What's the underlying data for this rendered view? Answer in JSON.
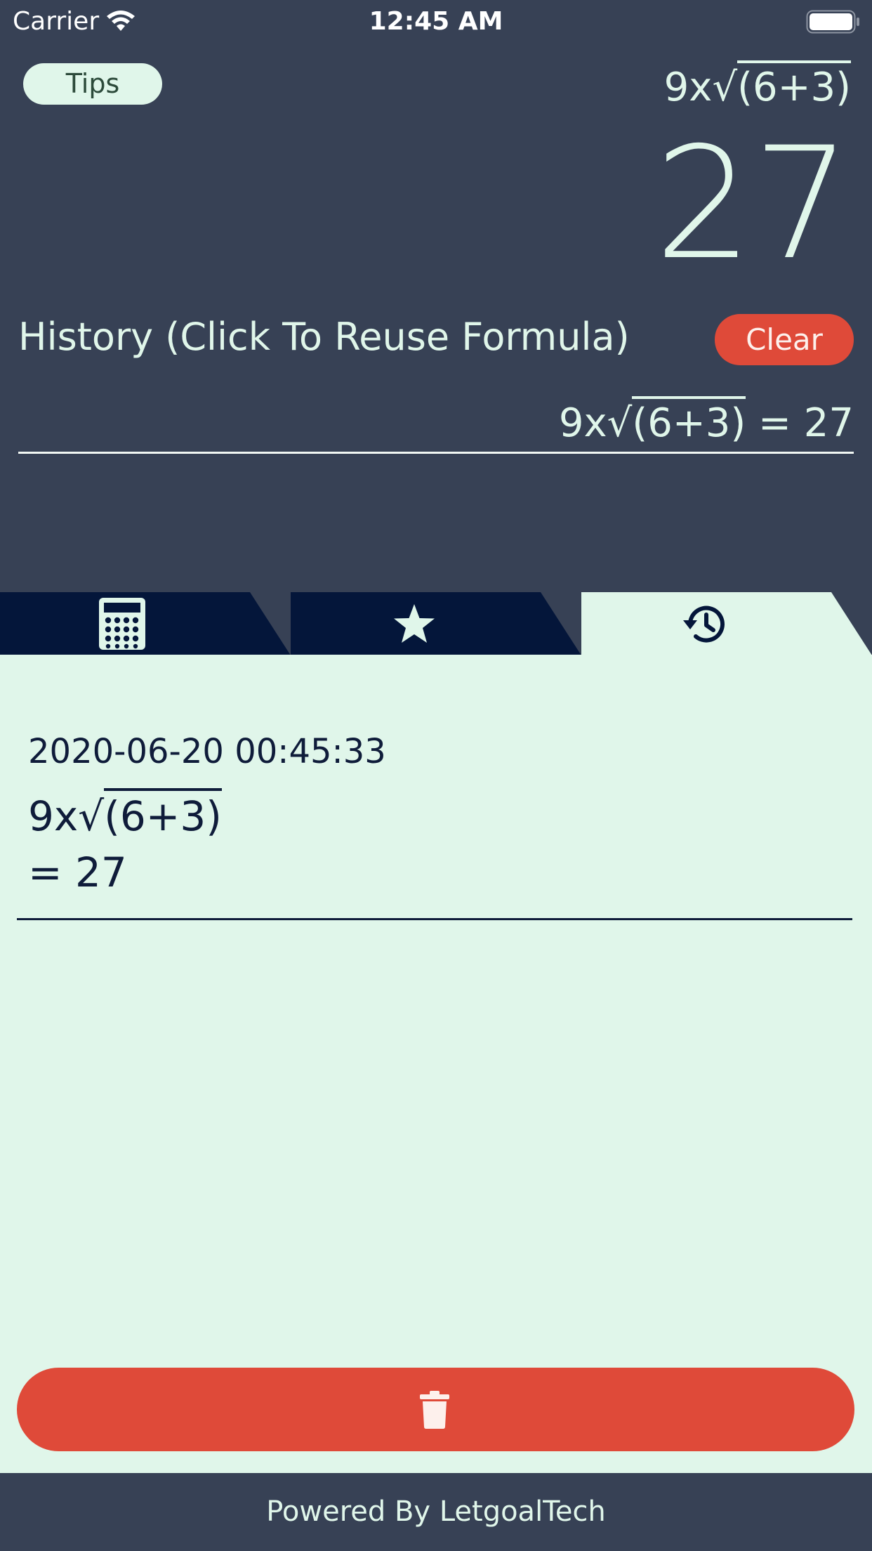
{
  "status_bar": {
    "carrier": "Carrier",
    "time": "12:45 AM"
  },
  "header": {
    "tips_label": "Tips",
    "expression_prefix": "9x√",
    "expression_radicand": "(6+3)",
    "result": "27"
  },
  "history": {
    "title": "History (Click To Reuse Formula)",
    "clear_label": "Clear",
    "entries": [
      {
        "prefix": "9x√",
        "radicand": "(6+3)",
        "suffix": " = 27"
      }
    ]
  },
  "tabs": [
    {
      "name": "calculator",
      "icon": "calculator-icon",
      "active": false
    },
    {
      "name": "favorites",
      "icon": "star-icon",
      "active": false
    },
    {
      "name": "history",
      "icon": "history-icon",
      "active": true
    }
  ],
  "records": [
    {
      "date": "2020-06-20 00:45:33",
      "expr_prefix": "9x√",
      "expr_radicand": "(6+3)",
      "result": "= 27"
    }
  ],
  "delete_button": {
    "icon": "trash-icon"
  },
  "footer": {
    "text": "Powered By LetgoalTech"
  },
  "colors": {
    "background": "#374155",
    "panel": "#e0f6ea",
    "accent_red": "#df4a39",
    "tab_dark": "#04163a",
    "text_dark": "#0f1c3a"
  }
}
